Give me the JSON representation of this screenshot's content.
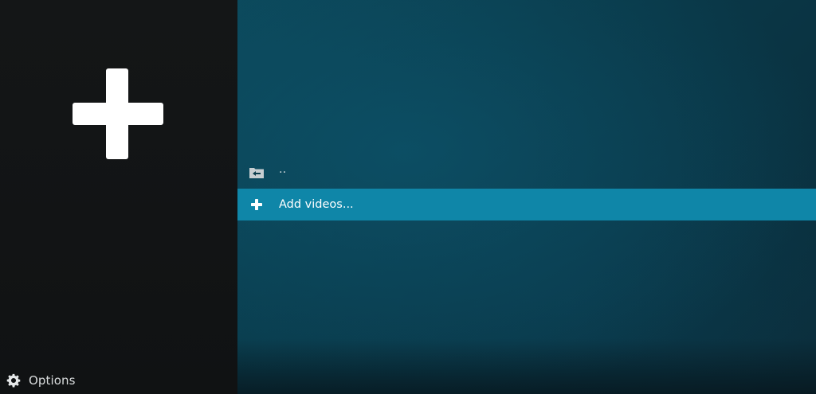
{
  "sidebar": {
    "thumbnail_icon": "plus-icon",
    "options": {
      "label": "Options",
      "icon": "gear-icon"
    }
  },
  "list": {
    "items": [
      {
        "label": "..",
        "icon": "folder-back-icon",
        "selected": false
      },
      {
        "label": "Add videos...",
        "icon": "plus-icon",
        "selected": true
      }
    ]
  },
  "colors": {
    "sidebar_bg": "#131516",
    "main_bg": "#0a3b4b",
    "highlight": "#0f86a8",
    "text": "#ffffff"
  }
}
